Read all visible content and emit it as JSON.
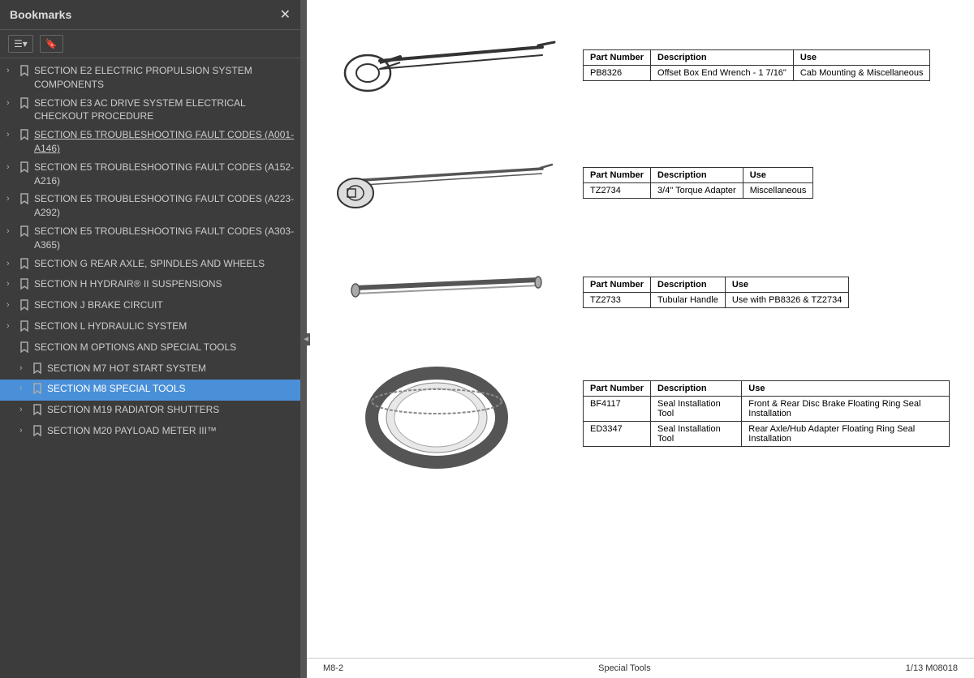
{
  "sidebar": {
    "title": "Bookmarks",
    "close_label": "✕",
    "toolbar": {
      "btn1_label": "☰▾",
      "btn2_label": "🔖"
    },
    "items": [
      {
        "id": "e2",
        "level": 0,
        "expandable": true,
        "text": "SECTION E2 ELECTRIC PROPULSION SYSTEM COMPONENTS",
        "underline": false,
        "active": false
      },
      {
        "id": "e3",
        "level": 0,
        "expandable": true,
        "text": "SECTION E3 AC DRIVE SYSTEM ELECTRICAL CHECKOUT PROCEDURE",
        "underline": false,
        "active": false
      },
      {
        "id": "e5-a001",
        "level": 0,
        "expandable": true,
        "text": "SECTION E5 TROUBLESHOOTING FAULT CODES (A001-A146)",
        "underline": true,
        "active": false
      },
      {
        "id": "e5-a152",
        "level": 0,
        "expandable": true,
        "text": "SECTION E5 TROUBLESHOOTING FAULT CODES (A152-A216)",
        "underline": false,
        "active": false
      },
      {
        "id": "e5-a223",
        "level": 0,
        "expandable": true,
        "text": "SECTION E5 TROUBLESHOOTING FAULT CODES (A223-A292)",
        "underline": false,
        "active": false
      },
      {
        "id": "e5-a303",
        "level": 0,
        "expandable": true,
        "text": "SECTION E5 TROUBLESHOOTING FAULT CODES (A303-A365)",
        "underline": false,
        "active": false
      },
      {
        "id": "g",
        "level": 0,
        "expandable": true,
        "text": "SECTION G REAR AXLE, SPINDLES AND WHEELS",
        "underline": false,
        "active": false
      },
      {
        "id": "h",
        "level": 0,
        "expandable": true,
        "text": "SECTION H HYDRAIR® II SUSPENSIONS",
        "underline": false,
        "active": false
      },
      {
        "id": "j",
        "level": 0,
        "expandable": true,
        "text": "SECTION J BRAKE CIRCUIT",
        "underline": false,
        "active": false
      },
      {
        "id": "l",
        "level": 0,
        "expandable": true,
        "text": "SECTION L HYDRAULIC SYSTEM",
        "underline": false,
        "active": false
      },
      {
        "id": "m",
        "level": 0,
        "expandable": false,
        "text": "SECTION M OPTIONS AND SPECIAL TOOLS",
        "underline": false,
        "active": false
      },
      {
        "id": "m7",
        "level": 1,
        "expandable": true,
        "text": "SECTION M7 HOT START SYSTEM",
        "underline": false,
        "active": false
      },
      {
        "id": "m8",
        "level": 1,
        "expandable": true,
        "text": "SECTION M8 SPECIAL TOOLS",
        "underline": false,
        "active": true
      },
      {
        "id": "m19",
        "level": 1,
        "expandable": true,
        "text": "SECTION M19 RADIATOR SHUTTERS",
        "underline": false,
        "active": false
      },
      {
        "id": "m20",
        "level": 1,
        "expandable": true,
        "text": "SECTION M20 PAYLOAD METER III™",
        "underline": false,
        "active": false
      }
    ]
  },
  "tools": [
    {
      "id": "tool1",
      "part_number": "PB8326",
      "description": "Offset Box End Wrench - 1 7/16\"",
      "use": "Cab Mounting & Miscellaneous"
    },
    {
      "id": "tool2",
      "part_number": "TZ2734",
      "description": "3/4\" Torque Adapter",
      "use": "Miscellaneous"
    },
    {
      "id": "tool3",
      "part_number": "TZ2733",
      "description": "Tubular Handle",
      "use": "Use with PB8326 & TZ2734"
    },
    {
      "id": "tool4a",
      "part_number": "BF4117",
      "description": "Seal Installation Tool",
      "use": "Front & Rear Disc Brake Floating Ring Seal Installation"
    },
    {
      "id": "tool4b",
      "part_number": "ED3347",
      "description": "Seal Installation Tool",
      "use": "Rear Axle/Hub Adapter Floating Ring Seal Installation"
    }
  ],
  "table_headers": {
    "part_number": "Part Number",
    "description": "Description",
    "use": "Use"
  },
  "footer": {
    "page_id": "M8-2",
    "section": "Special Tools",
    "doc_ref": "1/13  M08018"
  }
}
